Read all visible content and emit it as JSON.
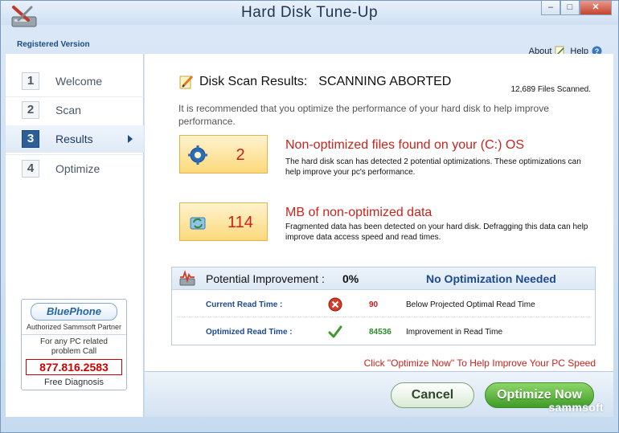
{
  "window": {
    "title": "Hard Disk Tune-Up",
    "registered": "Registered Version",
    "links": {
      "about": "About",
      "help": "Help"
    }
  },
  "steps": [
    {
      "num": "1",
      "label": "Welcome",
      "active": false
    },
    {
      "num": "2",
      "label": "Scan",
      "active": false
    },
    {
      "num": "3",
      "label": "Results",
      "active": true
    },
    {
      "num": "4",
      "label": "Optimize",
      "active": false
    }
  ],
  "sidebar": {
    "bluephone": {
      "logo": "BluePhone",
      "authorized": "Authorized Sammsoft Partner",
      "line1": "For any PC related",
      "line2": "problem Call",
      "phone": "877.816.2583",
      "free": "Free Diagnosis"
    }
  },
  "main": {
    "scan_title": "Disk Scan Results:",
    "scan_status": "SCANNING ABORTED",
    "files_scanned": "12,689 Files Scanned.",
    "intro": "It is recommended that you optimize the performance of your hard disk to help improve performance.",
    "result1": {
      "value": "2",
      "title": "Non-optimized files found on your (C:) OS",
      "desc": "The hard disk scan has detected 2 potential optimizations. These optimizations can help improve your pc's performance."
    },
    "result2": {
      "value": "114",
      "title": "MB of non-optimized data",
      "desc": "Fragmented data has been detected on your hard disk. Defragging this data can help improve data access speed and read times."
    },
    "improvement": {
      "label": "Potential Improvement :",
      "value": "0%",
      "status": "No Optimization Needed",
      "current": {
        "label": "Current Read Time :",
        "value": "90",
        "note": "Below Projected Optimal Read Time"
      },
      "optimized": {
        "label": "Optimized Read Time :",
        "value": "84536",
        "note": "Improvement in Read Time"
      }
    },
    "click_note": "Click  \"Optimize Now\"  To Help Improve Your PC Speed"
  },
  "buttons": {
    "cancel": "Cancel",
    "optimize": "Optimize Now"
  },
  "brand": "sammsoft",
  "colors": {
    "accent_red": "#c8241c",
    "accent_blue": "#1d4a8e",
    "optimize_green": "#3f9b26"
  }
}
